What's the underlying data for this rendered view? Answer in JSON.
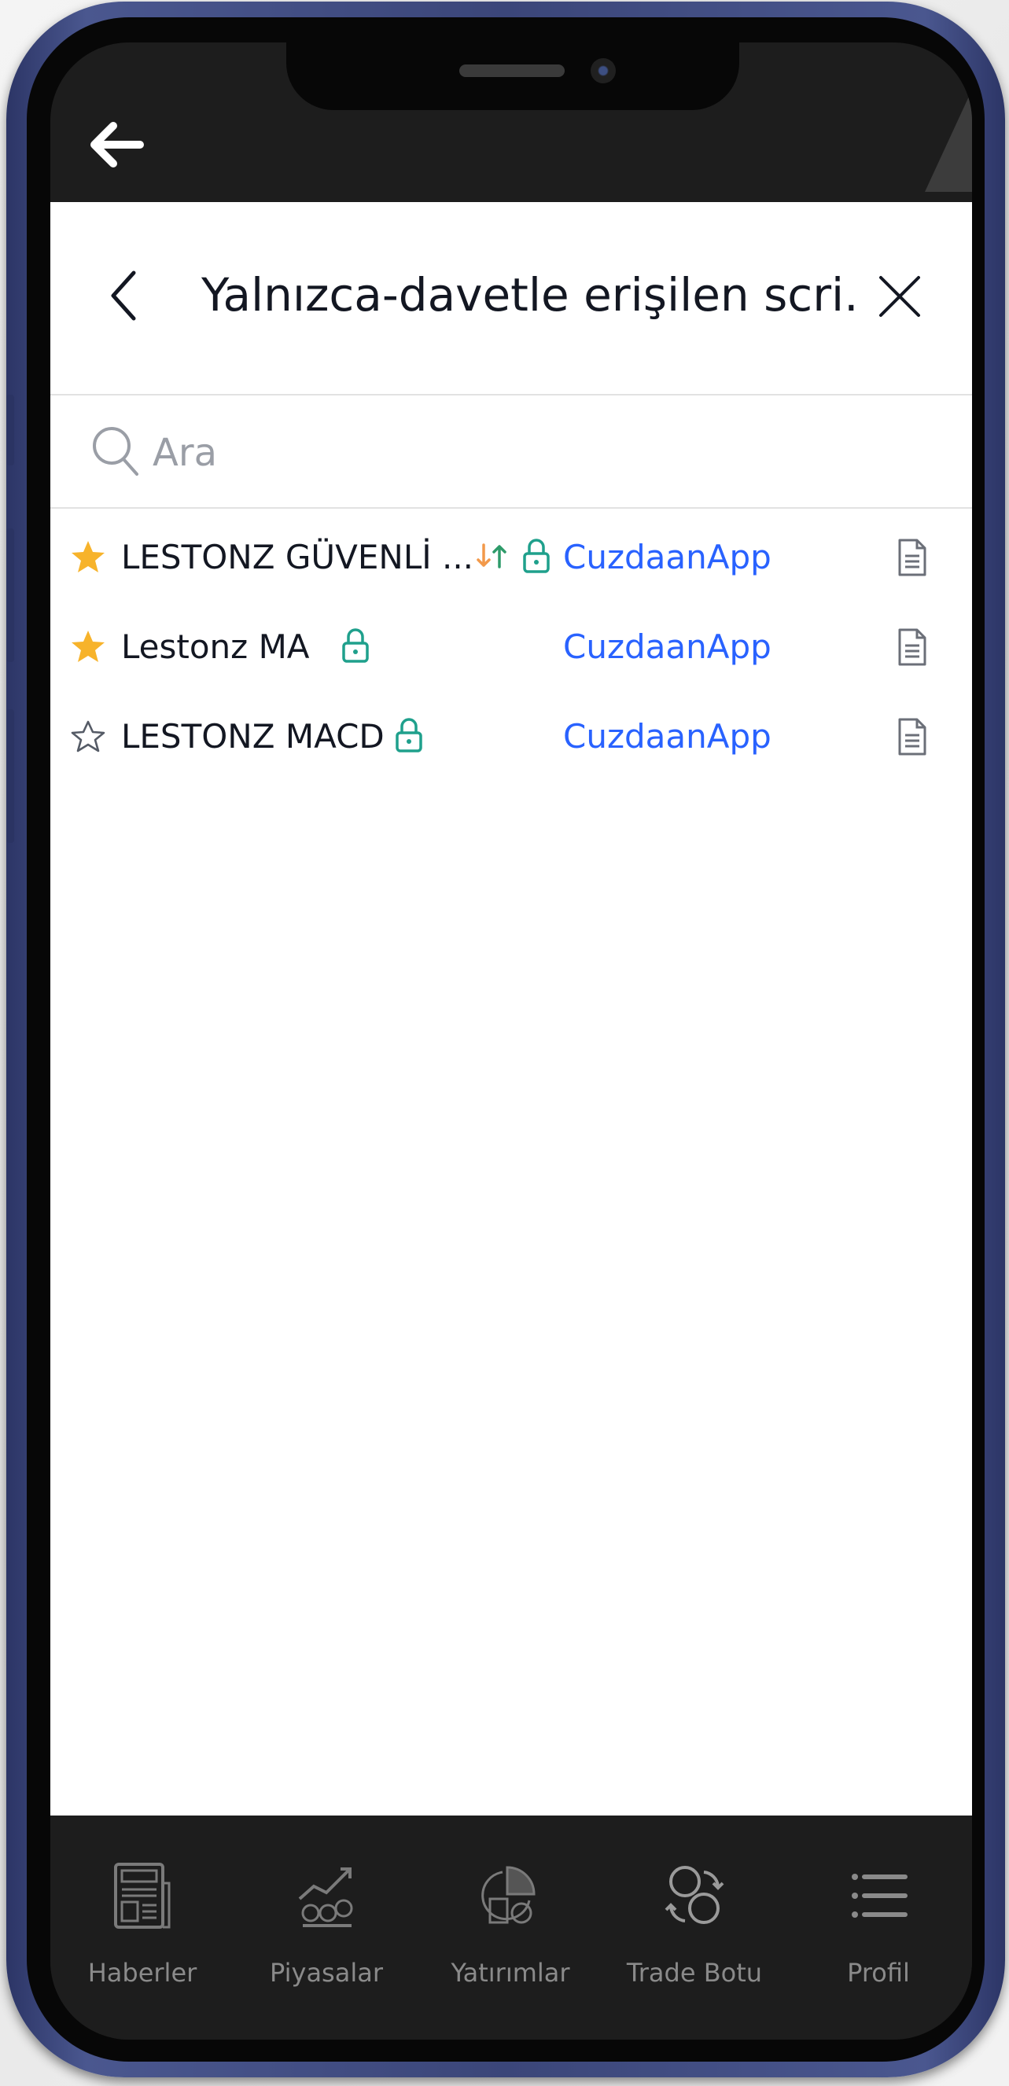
{
  "header": {
    "title": "Yalnızca-davetle erişilen scri..."
  },
  "search": {
    "placeholder": "Ara"
  },
  "scripts": [
    {
      "name": "LESTONZ GÜVENLİ ...",
      "starred": true,
      "has_signal_icon": true,
      "locked": true,
      "author": "CuzdaanApp"
    },
    {
      "name": "Lestonz MA",
      "starred": true,
      "has_signal_icon": false,
      "locked": true,
      "author": "CuzdaanApp"
    },
    {
      "name": "LESTONZ MACD",
      "starred": false,
      "has_signal_icon": false,
      "locked": true,
      "author": "CuzdaanApp"
    }
  ],
  "icons": {
    "outer_back": "arrow-left-icon",
    "back": "chevron-left-icon",
    "close": "close-icon",
    "search": "search-icon",
    "star_filled": "star-filled-icon",
    "star_outline": "star-outline-icon",
    "signal": "arrows-up-down-icon",
    "lock": "lock-icon",
    "document": "document-icon"
  },
  "colors": {
    "star": "#f7b32b",
    "lock": "#1fa08c",
    "author_link": "#2962ff",
    "arrow_down": "#f2994a",
    "arrow_up": "#2e9b6a",
    "tabbar_bg": "#1d1d1d",
    "tab_label": "#8a8a8a"
  },
  "tabbar": {
    "tabs": [
      {
        "label": "Haberler",
        "icon": "newspaper-icon"
      },
      {
        "label": "Piyasalar",
        "icon": "market-chart-icon"
      },
      {
        "label": "Yatırımlar",
        "icon": "investments-icon"
      },
      {
        "label": "Trade Botu",
        "icon": "coin-exchange-icon"
      },
      {
        "label": "Profil",
        "icon": "menu-list-icon"
      }
    ]
  }
}
